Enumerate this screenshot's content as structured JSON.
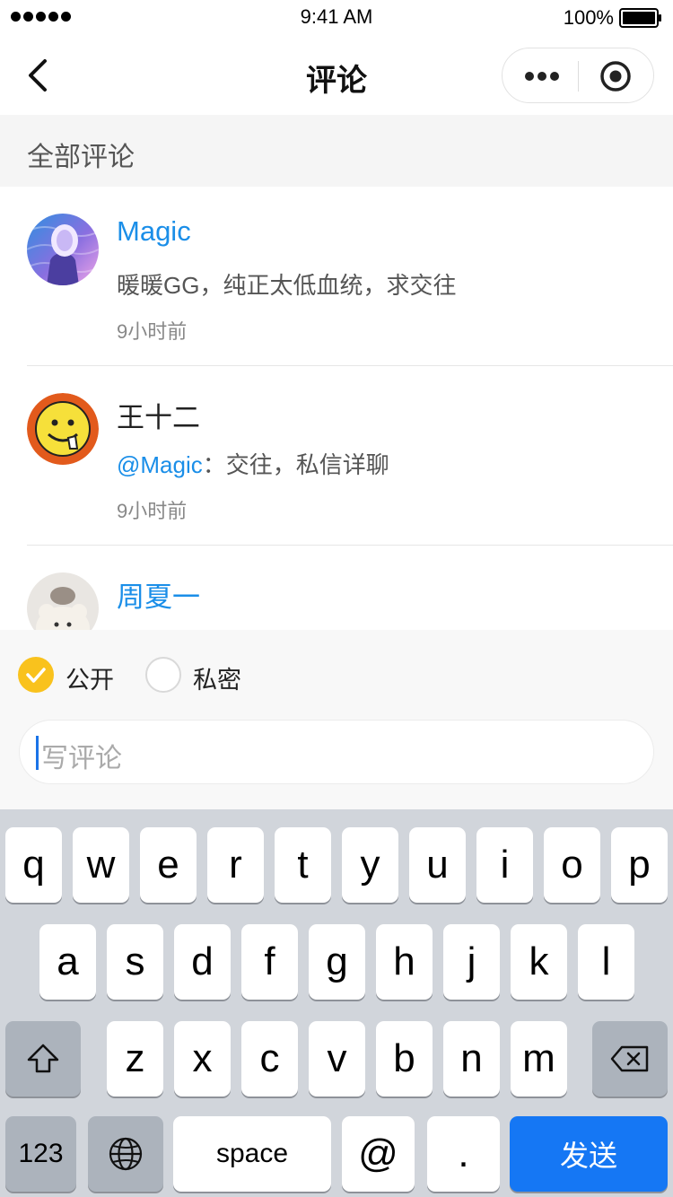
{
  "status_bar": {
    "time": "9:41 AM",
    "battery": "100%"
  },
  "nav": {
    "title": "评论"
  },
  "section": {
    "title": "全部评论"
  },
  "comments": [
    {
      "name": "Magic",
      "name_color": "#1a8ee8",
      "text": "暖暖GG，纯正太低血统，求交往",
      "time": "9小时前"
    },
    {
      "name": "王十二",
      "name_color": "#222222",
      "mention": "@Magic",
      "text": "：交往，私信详聊",
      "time": "9小时前"
    },
    {
      "name": "周夏一",
      "name_color": "#1a8ee8",
      "text": "",
      "time": ""
    }
  ],
  "composer": {
    "option_public": "公开",
    "option_private": "私密",
    "selected": "公开",
    "placeholder": "写评论"
  },
  "keyboard": {
    "row1": [
      "q",
      "w",
      "e",
      "r",
      "t",
      "y",
      "u",
      "i",
      "o",
      "p"
    ],
    "row2": [
      "a",
      "s",
      "d",
      "f",
      "g",
      "h",
      "j",
      "k",
      "l"
    ],
    "row3": [
      "z",
      "x",
      "c",
      "v",
      "b",
      "n",
      "m"
    ],
    "numbers_key": "123",
    "space_key": "space",
    "at_key": "@",
    "period_key": ".",
    "send_key": "发送"
  },
  "icons": [
    "back-icon",
    "more-icon",
    "close-mini-program-icon",
    "shift-icon",
    "backspace-icon",
    "globe-icon",
    "checkmark-icon"
  ],
  "colors": {
    "accent_blue": "#1a8ee8",
    "send_blue": "#1577f4",
    "checked_yellow": "#f9c21d"
  }
}
